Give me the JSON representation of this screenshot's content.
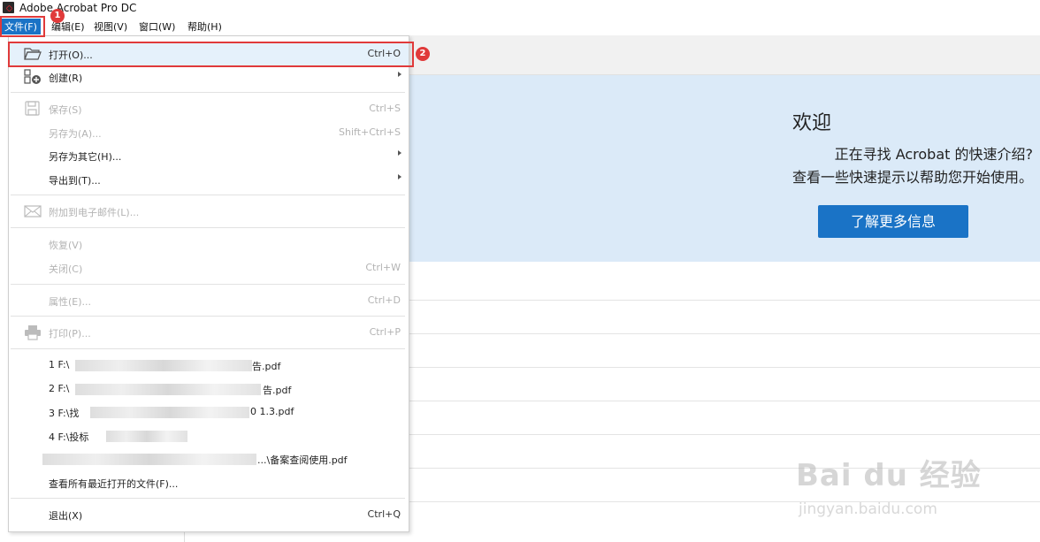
{
  "window": {
    "title": "Adobe Acrobat Pro DC"
  },
  "menubar": {
    "items": [
      "文件(F)",
      "编辑(E)",
      "视图(V)",
      "窗口(W)",
      "帮助(H)"
    ]
  },
  "annotations": {
    "badge1": "1",
    "badge2": "2"
  },
  "welcome": {
    "title": "欢迎",
    "line1": "正在寻找 Acrobat 的快速介绍?",
    "line2": "查看一些快速提示以帮助您开始使用。",
    "button": "了解更多信息"
  },
  "file_menu": {
    "open": {
      "label": "打开(O)...",
      "shortcut": "Ctrl+O"
    },
    "create": {
      "label": "创建(R)"
    },
    "save": {
      "label": "保存(S)",
      "shortcut": "Ctrl+S"
    },
    "save_as": {
      "label": "另存为(A)...",
      "shortcut": "Shift+Ctrl+S"
    },
    "save_as_other": {
      "label": "另存为其它(H)..."
    },
    "export_to": {
      "label": "导出到(T)..."
    },
    "attach_email": {
      "label": "附加到电子邮件(L)..."
    },
    "revert": {
      "label": "恢复(V)"
    },
    "close": {
      "label": "关闭(C)",
      "shortcut": "Ctrl+W"
    },
    "properties": {
      "label": "属性(E)...",
      "shortcut": "Ctrl+D"
    },
    "print": {
      "label": "打印(P)...",
      "shortcut": "Ctrl+P"
    },
    "recent": [
      {
        "prefix": "1 F:\\",
        "suffix": "告.pdf"
      },
      {
        "prefix": "2 F:\\",
        "suffix": "告.pdf"
      },
      {
        "prefix": "3 F:\\找",
        "suffix": "0 1.3.pdf"
      },
      {
        "prefix": "4 F:\\投标",
        "suffix": ""
      },
      {
        "prefix": "",
        "suffix": "...\\备案查阅使用.pdf"
      }
    ],
    "view_all_recent": {
      "label": "查看所有最近打开的文件(F)..."
    },
    "exit": {
      "label": "退出(X)",
      "shortcut": "Ctrl+Q"
    }
  },
  "watermark": {
    "line1": "Bai du 经验",
    "line2": "jingyan.baidu.com"
  },
  "colors": {
    "accent": "#1a73c6",
    "annotation": "#e03a3a",
    "welcome_bg": "#dbeaf8"
  }
}
